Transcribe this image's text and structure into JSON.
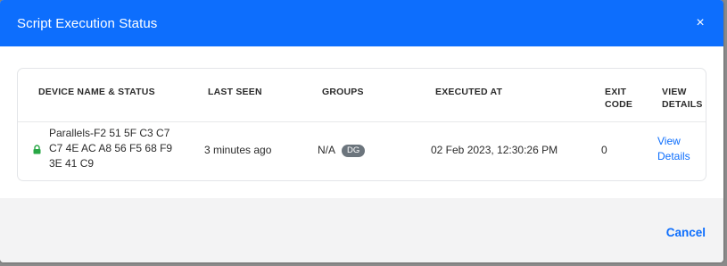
{
  "modal": {
    "title": "Script Execution Status",
    "close_label": "×"
  },
  "table": {
    "columns": {
      "device": "DEVICE NAME & STATUS",
      "last_seen": "LAST SEEN",
      "groups": "GROUPS",
      "executed_at": "EXECUTED AT",
      "exit_code_1": "EXIT",
      "exit_code_2": "CODE",
      "view_details_1": "VIEW",
      "view_details_2": "DETAILS"
    },
    "rows": [
      {
        "device_line1": "Parallels-F2 51 5F C3 C7",
        "device_line2": "C7 4E AC A8 56 F5 68 F9",
        "device_line3": "3E 41 C9",
        "status_icon": "lock-icon",
        "last_seen": "3 minutes ago",
        "groups": "N/A",
        "group_badge": "DG",
        "executed_at": "02 Feb 2023, 12:30:26 PM",
        "exit_code": "0",
        "view_details_1": "View",
        "view_details_2": "Details"
      }
    ]
  },
  "footer": {
    "cancel_label": "Cancel"
  },
  "colors": {
    "header_bg": "#0d6efd",
    "link": "#0d6efd",
    "lock_icon": "#28a745",
    "badge_bg": "#6c757d",
    "footer_bg": "#f3f3f4"
  }
}
